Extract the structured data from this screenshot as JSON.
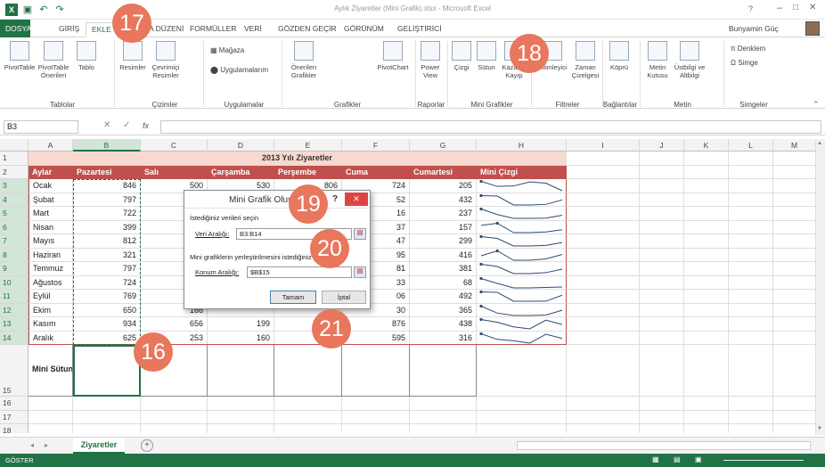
{
  "title_bar": {
    "title": "Aylık Ziyaretler (Mini Grafik).xlsx - Microsoft Excel",
    "user": "Bunyamin Güç"
  },
  "tabs": [
    "DOSYA",
    "GİRİŞ",
    "EKLE",
    "SAYFA DÜZENİ",
    "FORMÜLLER",
    "VERİ",
    "GÖZDEN GEÇİR",
    "GÖRÜNÜM",
    "GELİŞTİRİCİ"
  ],
  "active_tab": "EKLE",
  "ribbon": {
    "groups": [
      {
        "name": "Tablolar",
        "items": [
          "PivotTable",
          "PivotTable Önerileri",
          "Tablo"
        ]
      },
      {
        "name": "Çizimler",
        "items": [
          "Resimler",
          "Çevrimiçi Resimler"
        ]
      },
      {
        "name": "Uygulamalar",
        "items": [
          "Mağaza",
          "Uygulamalarım"
        ]
      },
      {
        "name": "Grafikler",
        "items": [
          "Önerilen Grafikler",
          "PivotChart"
        ]
      },
      {
        "name": "Raporlar",
        "items": [
          "Power View"
        ]
      },
      {
        "name": "Mini Grafikler",
        "items": [
          "Çizgi",
          "Sütun",
          "Kazanç/ Kayıp"
        ]
      },
      {
        "name": "Filtreler",
        "items": [
          "Dilimleyici",
          "Zaman Çizelgesi"
        ]
      },
      {
        "name": "Bağlantılar",
        "items": [
          "Köprü"
        ]
      },
      {
        "name": "Metin",
        "items": [
          "Metin Kutusu",
          "Üstbilgi ve Altbilgi"
        ]
      },
      {
        "name": "Simgeler",
        "items": [
          "Denklem",
          "Simge"
        ]
      }
    ]
  },
  "formula_bar": {
    "name_box": "B3",
    "fx": "fx",
    "content": ""
  },
  "columns": [
    "A",
    "B",
    "C",
    "D",
    "E",
    "F",
    "G",
    "H",
    "I",
    "J",
    "K",
    "L",
    "M"
  ],
  "table": {
    "title": "2013 Yılı Ziyaretler",
    "headers": [
      "Aylar",
      "Pazartesi",
      "Salı",
      "Çarşamba",
      "Perşembe",
      "Cuma",
      "Cumartesi",
      "Mini Çizgi"
    ],
    "rows": [
      {
        "month": "Ocak",
        "b": "846",
        "c": "500",
        "d": "530",
        "e": "806",
        "f": "724",
        "g": "205"
      },
      {
        "month": "Şubat",
        "b": "797",
        "c": "755",
        "d": "",
        "e": "",
        "f": "52",
        "g": "432"
      },
      {
        "month": "Mart",
        "b": "722",
        "c": "294",
        "d": "",
        "e": "",
        "f": "16",
        "g": "237"
      },
      {
        "month": "Nisan",
        "b": "399",
        "c": "515",
        "d": "",
        "e": "",
        "f": "37",
        "g": "157"
      },
      {
        "month": "Mayıs",
        "b": "812",
        "c": "655",
        "d": "",
        "e": "",
        "f": "47",
        "g": "299"
      },
      {
        "month": "Haziran",
        "b": "321",
        "c": "670",
        "d": "",
        "e": "",
        "f": "95",
        "g": "416"
      },
      {
        "month": "Temmuz",
        "b": "797",
        "c": "608",
        "d": "",
        "e": "",
        "f": "81",
        "g": "381"
      },
      {
        "month": "Ağustos",
        "b": "724",
        "c": "345",
        "d": "",
        "e": "",
        "f": "33",
        "g": "68"
      },
      {
        "month": "Eylül",
        "b": "769",
        "c": "729",
        "d": "",
        "e": "",
        "f": "06",
        "g": "492"
      },
      {
        "month": "Ekim",
        "b": "650",
        "c": "166",
        "d": "",
        "e": "",
        "f": "30",
        "g": "365"
      },
      {
        "month": "Kasım",
        "b": "934",
        "c": "656",
        "d": "199",
        "e": "2",
        "f": "876",
        "g": "438"
      },
      {
        "month": "Aralık",
        "b": "625",
        "c": "253",
        "d": "160",
        "e": "5",
        "f": "595",
        "g": "316"
      }
    ],
    "mini_sutun_label": "Mini Sütun"
  },
  "row_numbers": [
    "1",
    "2",
    "3",
    "4",
    "5",
    "6",
    "7",
    "8",
    "9",
    "10",
    "11",
    "12",
    "13",
    "14",
    "15",
    "16",
    "17",
    "18",
    "19"
  ],
  "dialog": {
    "title": "Mini Grafik Oluştur",
    "help": "?",
    "close": "✕",
    "section1": "İstediğiniz verileri seçin",
    "data_range_label": "Veri Aralığı:",
    "data_range_value": "B3:B14",
    "section2": "Mini grafiklerin yerleştirilmesini istediğiniz yeri seçin",
    "location_label": "Konum Aralığı:",
    "location_value": "$B$15",
    "ok": "Tamam",
    "cancel": "İptal"
  },
  "callouts": [
    "16",
    "17",
    "18",
    "19",
    "20",
    "21"
  ],
  "sheet_tab": "Ziyaretler",
  "status": "GÖSTER",
  "colors": {
    "excel_green": "#217346",
    "header_red": "#c0504d",
    "title_fill": "#f8d9cf",
    "callout": "#e8775e"
  }
}
